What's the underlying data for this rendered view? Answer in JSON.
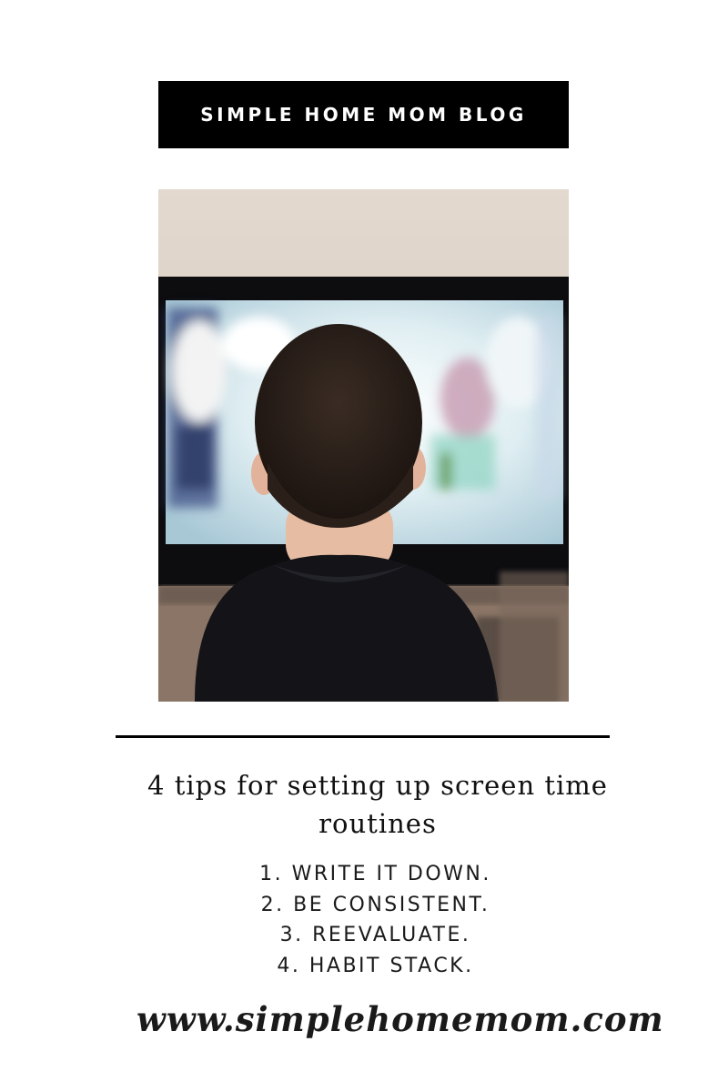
{
  "banner": {
    "title": "SIMPLE HOME MOM BLOG"
  },
  "photo": {
    "subject": "child-watching-tv-photo"
  },
  "headline": {
    "text": "4 tips for setting up screen time routines"
  },
  "tips": [
    {
      "label": "1. WRITE IT DOWN."
    },
    {
      "label": "2. BE CONSISTENT."
    },
    {
      "label": "3. REEVALUATE."
    },
    {
      "label": "4. HABIT STACK."
    }
  ],
  "footer": {
    "url": "www.simplehomemom.com"
  },
  "colors": {
    "background": "#ffffff",
    "banner_bg": "#000000",
    "banner_text": "#ffffff",
    "text": "#111111"
  }
}
